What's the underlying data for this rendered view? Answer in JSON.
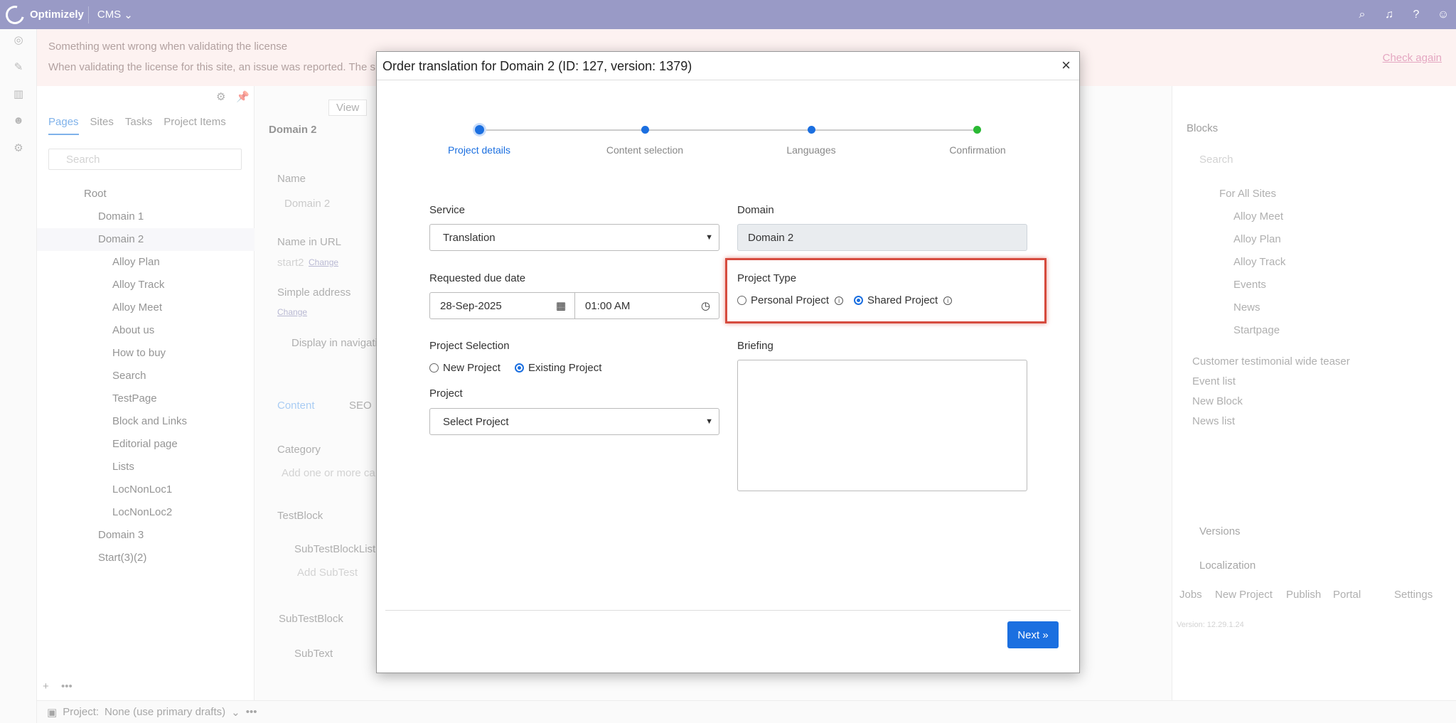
{
  "topbar": {
    "brand": "Optimizely",
    "product": "CMS"
  },
  "notice": {
    "line1": "Something went wrong when validating the license",
    "line2": "When validating the license for this site, an issue was reported. The s",
    "action": "Check again"
  },
  "tree": {
    "tabs": [
      "Pages",
      "Sites",
      "Tasks",
      "Project Items"
    ],
    "search_placeholder": "Search",
    "nodes": [
      "Root",
      "Domain 1",
      "Domain 2",
      "Alloy Plan",
      "Alloy Track",
      "Alloy Meet",
      "About us",
      "How to buy",
      "Search",
      "TestPage",
      "Block and Links",
      "Editorial page",
      "Lists",
      "LocNonLoc1",
      "LocNonLoc2",
      "Domain 3",
      "Start(3)(2)"
    ]
  },
  "editor": {
    "view_button": "View",
    "page_title": "Domain 2",
    "name_label": "Name",
    "name_value": "Domain 2",
    "name_in_url_label": "Name in URL",
    "url_value": "start2",
    "change_link": "Change",
    "simple_address_label": "Simple address",
    "display_in_nav": "Display in navigati",
    "tab_content": "Content",
    "tab_seo": "SEO",
    "category_label": "Category",
    "category_placeholder": "Add one or more ca",
    "testblock_label": "TestBlock",
    "subtestblocklist_label": "SubTestBlockList",
    "add_subtest": "Add SubTest",
    "subtestblock_label": "SubTestBlock",
    "subtext_label": "SubText"
  },
  "right": {
    "blocks_title": "Blocks",
    "search_placeholder": "Search",
    "folders": [
      "For All Sites",
      "Alloy Meet",
      "Alloy Plan",
      "Alloy Track",
      "Events",
      "News",
      "Startpage"
    ],
    "blocks": [
      "Customer testimonial wide teaser",
      "Event list",
      "New Block",
      "News list"
    ],
    "versions": "Versions",
    "localization": "Localization",
    "loc_buttons": [
      "Jobs",
      "New Project",
      "Publish",
      "Portal",
      "Settings"
    ],
    "version_text": "Version: 12.29.1.24"
  },
  "bottombar": {
    "project_label": "Project:",
    "project_value": "None (use primary drafts)"
  },
  "modal": {
    "title": "Order translation for Domain 2 (ID: 127, version: 1379)",
    "steps": [
      "Project details",
      "Content selection",
      "Languages",
      "Confirmation"
    ],
    "service_label": "Service",
    "service_value": "Translation",
    "domain_label": "Domain",
    "domain_value": "Domain 2",
    "due_date_label": "Requested due date",
    "due_date_value": "28-Sep-2025",
    "due_time_value": "01:00 AM",
    "project_type_label": "Project Type",
    "personal_project": "Personal Project",
    "shared_project": "Shared Project",
    "project_selection_label": "Project Selection",
    "new_project": "New Project",
    "existing_project": "Existing Project",
    "project_label": "Project",
    "project_select": "Select Project",
    "briefing_label": "Briefing",
    "next_button": "Next »",
    "selected_project_type": "Shared Project",
    "selected_project_selection": "Existing Project"
  }
}
